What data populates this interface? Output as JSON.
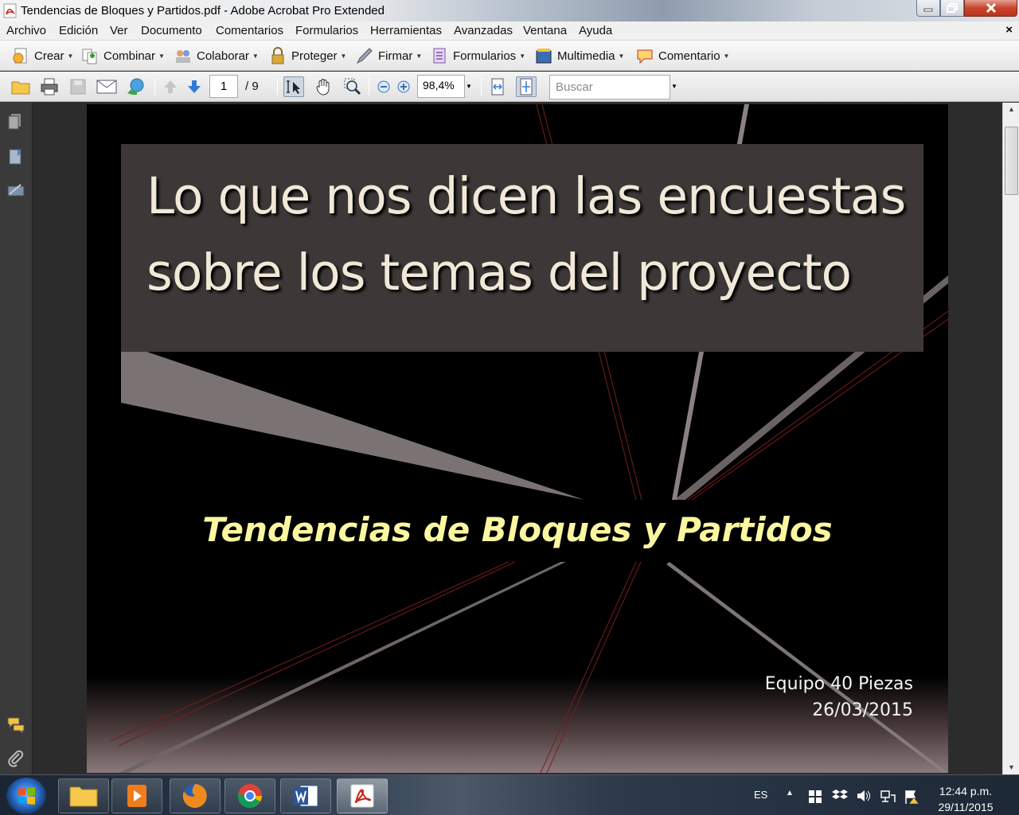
{
  "window": {
    "title": "Tendencias de Bloques y Partidos.pdf - Adobe Acrobat Pro Extended"
  },
  "menu": {
    "items": [
      "Archivo",
      "Edición",
      "Ver",
      "Documento",
      "Comentarios",
      "Formularios",
      "Herramientas",
      "Avanzadas",
      "Ventana",
      "Ayuda"
    ],
    "close_glyph": "×"
  },
  "tasks": {
    "items": [
      "Crear",
      "Combinar",
      "Colaborar",
      "Proteger",
      "Firmar",
      "Formularios",
      "Multimedia",
      "Comentario"
    ]
  },
  "navigation": {
    "current_page": "1",
    "page_total": "/ 9",
    "zoom": "98,4%",
    "search_placeholder": "Buscar"
  },
  "slide": {
    "title_line1": "Lo que nos dicen las encuestas",
    "title_line2": "sobre los temas del proyecto",
    "subtitle": "Tendencias de Bloques y Partidos",
    "author": "Equipo 40 Piezas",
    "date": "26/03/2015"
  },
  "taskbar": {
    "apps": [
      "file-explorer",
      "media-player",
      "firefox",
      "chrome",
      "word",
      "acrobat"
    ],
    "language": "ES",
    "time": "12:44 p.m.",
    "date": "29/11/2015"
  },
  "colors": {
    "slide_title": "#f1e8d8",
    "slide_subtitle": "#fbf7a0",
    "title_box": "#3d3837"
  }
}
